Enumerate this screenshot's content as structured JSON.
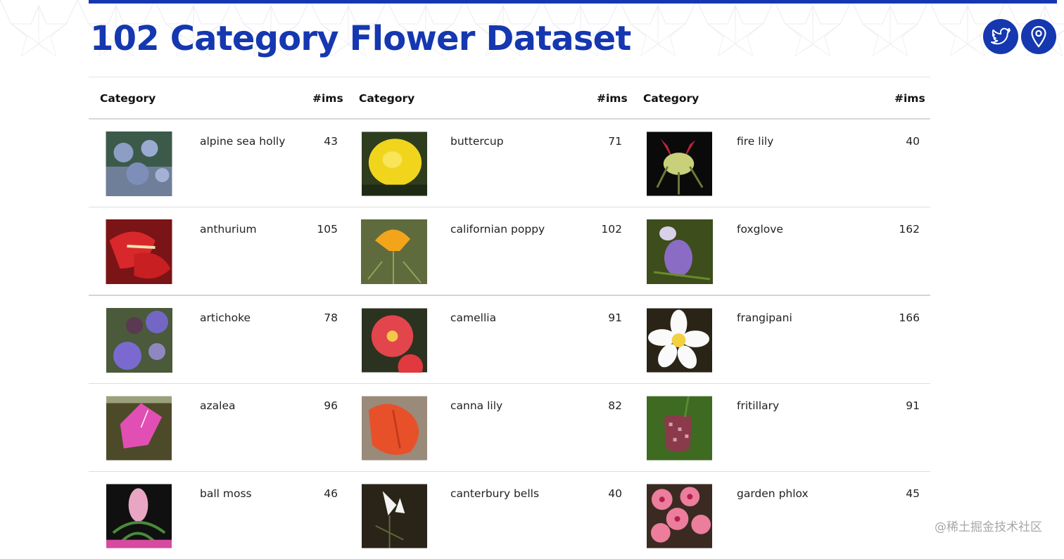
{
  "page": {
    "title": "102 Category Flower Dataset"
  },
  "header_icons": {
    "twitter": "twitter-icon",
    "location": "map-pin-icon"
  },
  "table": {
    "headers": [
      {
        "category": "Category",
        "count": "#ims"
      },
      {
        "category": "Category",
        "count": "#ims"
      },
      {
        "category": "Category",
        "count": "#ims"
      }
    ],
    "rows": [
      [
        {
          "name": "alpine sea holly",
          "count": "43"
        },
        {
          "name": "buttercup",
          "count": "71"
        },
        {
          "name": "fire lily",
          "count": "40"
        }
      ],
      [
        {
          "name": "anthurium",
          "count": "105"
        },
        {
          "name": "californian poppy",
          "count": "102"
        },
        {
          "name": "foxglove",
          "count": "162"
        }
      ],
      [
        {
          "name": "artichoke",
          "count": "78"
        },
        {
          "name": "camellia",
          "count": "91"
        },
        {
          "name": "frangipani",
          "count": "166"
        }
      ],
      [
        {
          "name": "azalea",
          "count": "96"
        },
        {
          "name": "canna lily",
          "count": "82"
        },
        {
          "name": "fritillary",
          "count": "91"
        }
      ],
      [
        {
          "name": "ball moss",
          "count": "46"
        },
        {
          "name": "canterbury bells",
          "count": "40"
        },
        {
          "name": "garden phlox",
          "count": "45"
        }
      ]
    ]
  },
  "watermark": "@稀土掘金技术社区",
  "colors": {
    "brand": "#1537b0"
  }
}
